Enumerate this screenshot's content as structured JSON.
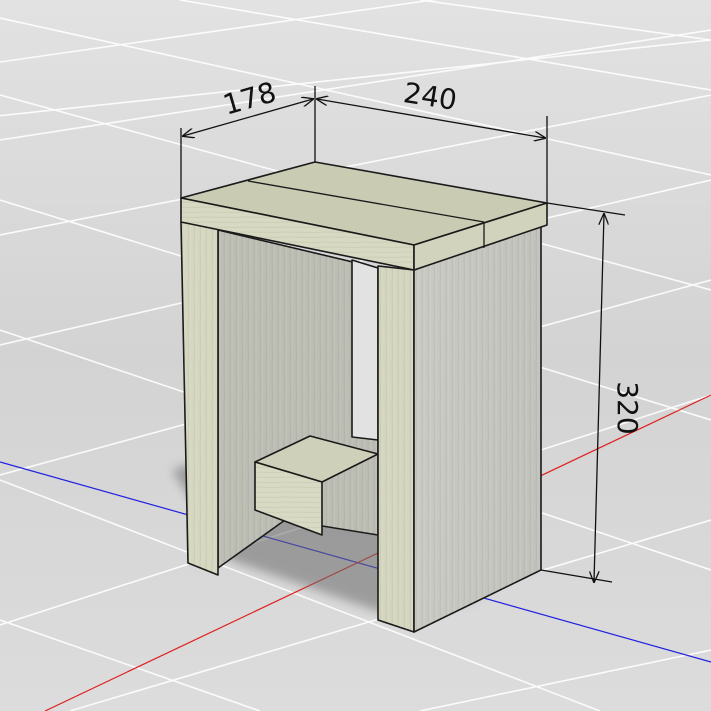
{
  "dimensions": {
    "depth": "178",
    "width": "240",
    "height": "320"
  },
  "colors": {
    "wood_top": "#c9cbb2",
    "wood_front": "#d7d8bf",
    "wood_side": "#c7c8c1",
    "wood_inner": "#bdbfb6",
    "edge": "#1a1a1a",
    "shadow": "#707070",
    "axis_red": "#e02020",
    "axis_blue": "#2020e0",
    "grid": "#ffffff",
    "dimension_line": "#111111"
  }
}
